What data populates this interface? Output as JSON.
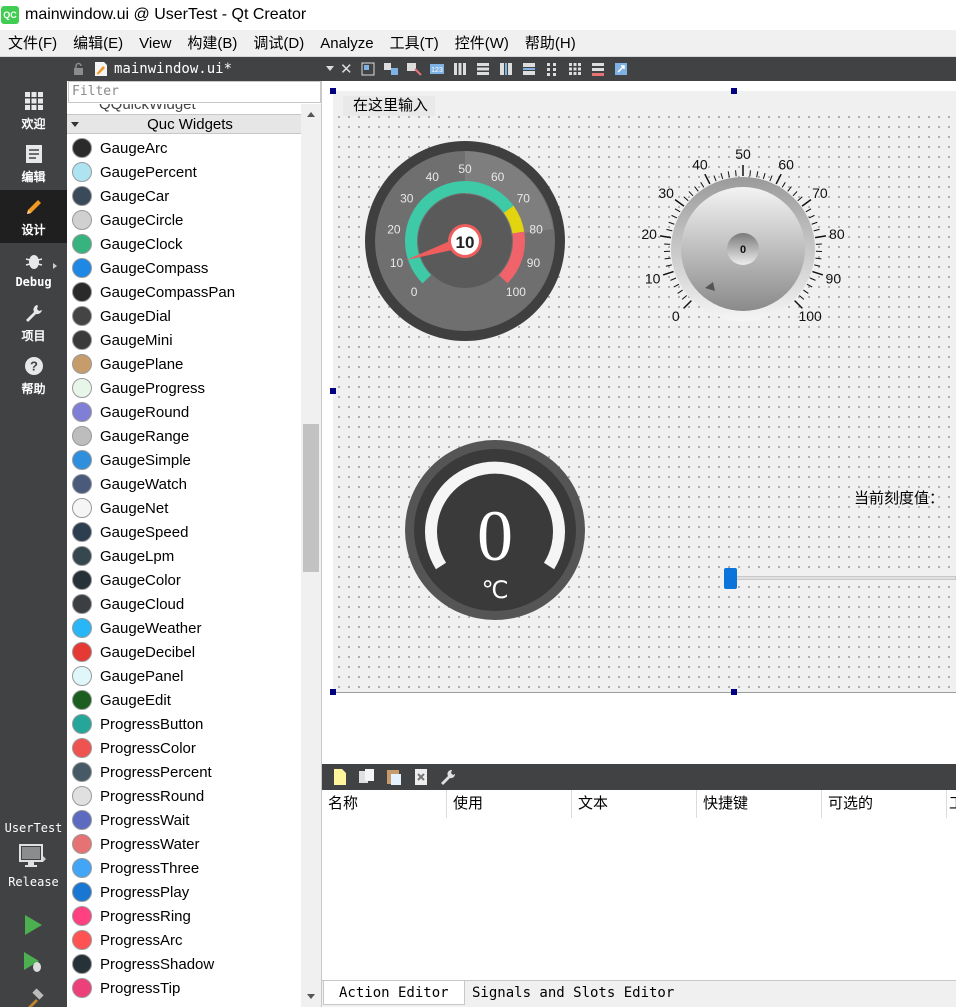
{
  "window": {
    "app_icon_text": "QC",
    "title": "mainwindow.ui @ UserTest - Qt Creator"
  },
  "menubar": [
    "文件(F)",
    "编辑(E)",
    "View",
    "构建(B)",
    "调试(D)",
    "Analyze",
    "工具(T)",
    "控件(W)",
    "帮助(H)"
  ],
  "modes": {
    "welcome": "欢迎",
    "edit": "编辑",
    "design": "设计",
    "debug": "Debug",
    "projects": "项目",
    "help": "帮助",
    "active": "design"
  },
  "kit": {
    "project": "UserTest",
    "build": "Release"
  },
  "editor": {
    "document": "mainwindow.ui*"
  },
  "widget_box": {
    "filter_placeholder": "Filter",
    "partial_item": "QQuickWidget",
    "category": "Quc Widgets",
    "items": [
      {
        "label": "GaugeArc",
        "icon": "gauge-arc-icon",
        "color": "#2b2b2b"
      },
      {
        "label": "GaugePercent",
        "icon": "gauge-percent-icon",
        "color": "#aee3f2"
      },
      {
        "label": "GaugeCar",
        "icon": "gauge-car-icon",
        "color": "#3a4a5a"
      },
      {
        "label": "GaugeCircle",
        "icon": "gauge-circle-icon",
        "color": "#d0d0d0"
      },
      {
        "label": "GaugeClock",
        "icon": "gauge-clock-icon",
        "color": "#36b37e"
      },
      {
        "label": "GaugeCompass",
        "icon": "gauge-compass-icon",
        "color": "#1e88e5"
      },
      {
        "label": "GaugeCompassPan",
        "icon": "gauge-compasspan-icon",
        "color": "#2a2a2a"
      },
      {
        "label": "GaugeDial",
        "icon": "gauge-dial-icon",
        "color": "#444444"
      },
      {
        "label": "GaugeMini",
        "icon": "gauge-mini-icon",
        "color": "#3a3a3a"
      },
      {
        "label": "GaugePlane",
        "icon": "gauge-plane-icon",
        "color": "#c69c6d"
      },
      {
        "label": "GaugeProgress",
        "icon": "gauge-progress-icon",
        "color": "#e8f5e9"
      },
      {
        "label": "GaugeRound",
        "icon": "gauge-round-icon",
        "color": "#7f7fd5"
      },
      {
        "label": "GaugeRange",
        "icon": "gauge-range-icon",
        "color": "#bdbdbd"
      },
      {
        "label": "GaugeSimple",
        "icon": "gauge-simple-icon",
        "color": "#2f8fdd"
      },
      {
        "label": "GaugeWatch",
        "icon": "gauge-watch-icon",
        "color": "#4a5a7a"
      },
      {
        "label": "GaugeNet",
        "icon": "gauge-net-icon",
        "color": "#f5f5f5"
      },
      {
        "label": "GaugeSpeed",
        "icon": "gauge-speed-icon",
        "color": "#2c3e50"
      },
      {
        "label": "GaugeLpm",
        "icon": "gauge-lpm-icon",
        "color": "#37474f"
      },
      {
        "label": "GaugeColor",
        "icon": "gauge-color-icon",
        "color": "#263238"
      },
      {
        "label": "GaugeCloud",
        "icon": "gauge-cloud-icon",
        "color": "#3c3f41"
      },
      {
        "label": "GaugeWeather",
        "icon": "gauge-weather-icon",
        "color": "#29b6f6"
      },
      {
        "label": "GaugeDecibel",
        "icon": "gauge-decibel-icon",
        "color": "#e53935"
      },
      {
        "label": "GaugePanel",
        "icon": "gauge-panel-icon",
        "color": "#e0f7fa"
      },
      {
        "label": "GaugeEdit",
        "icon": "gauge-edit-icon",
        "color": "#1b5e20"
      },
      {
        "label": "ProgressButton",
        "icon": "progress-button-icon",
        "color": "#26a69a"
      },
      {
        "label": "ProgressColor",
        "icon": "progress-color-icon",
        "color": "#ef5350"
      },
      {
        "label": "ProgressPercent",
        "icon": "progress-percent-icon",
        "color": "#455a64"
      },
      {
        "label": "ProgressRound",
        "icon": "progress-round-icon",
        "color": "#e0e0e0"
      },
      {
        "label": "ProgressWait",
        "icon": "progress-wait-icon",
        "color": "#5c6bc0"
      },
      {
        "label": "ProgressWater",
        "icon": "progress-water-icon",
        "color": "#e57373"
      },
      {
        "label": "ProgressThree",
        "icon": "progress-three-icon",
        "color": "#42a5f5"
      },
      {
        "label": "ProgressPlay",
        "icon": "progress-play-icon",
        "color": "#1976d2"
      },
      {
        "label": "ProgressRing",
        "icon": "progress-ring-icon",
        "color": "#ff4081"
      },
      {
        "label": "ProgressArc",
        "icon": "progress-arc-icon",
        "color": "#ff5252"
      },
      {
        "label": "ProgressShadow",
        "icon": "progress-shadow-icon",
        "color": "#263238"
      },
      {
        "label": "ProgressTip",
        "icon": "progress-tip-icon",
        "color": "#ec407a"
      }
    ]
  },
  "form": {
    "menu_placeholder": "在这里输入",
    "current_scale_label": "当前刻度值：",
    "gauge_arc": {
      "value": "10",
      "ticks": [
        "0",
        "10",
        "20",
        "30",
        "40",
        "50",
        "60",
        "70",
        "80",
        "90",
        "100"
      ]
    },
    "gauge_knob": {
      "value": "0",
      "ticks": [
        "0",
        "10",
        "20",
        "30",
        "40",
        "50",
        "60",
        "70",
        "80",
        "90",
        "100"
      ]
    },
    "gauge_temp": {
      "value": "0",
      "unit": "℃"
    },
    "slider": {
      "value": 0
    }
  },
  "action_editor": {
    "columns": [
      "名称",
      "使用",
      "文本",
      "快捷键",
      "可选的",
      "工"
    ]
  },
  "editor_tabs": {
    "action_editor": "Action Editor",
    "signals_slots": "Signals and Slots Editor"
  }
}
